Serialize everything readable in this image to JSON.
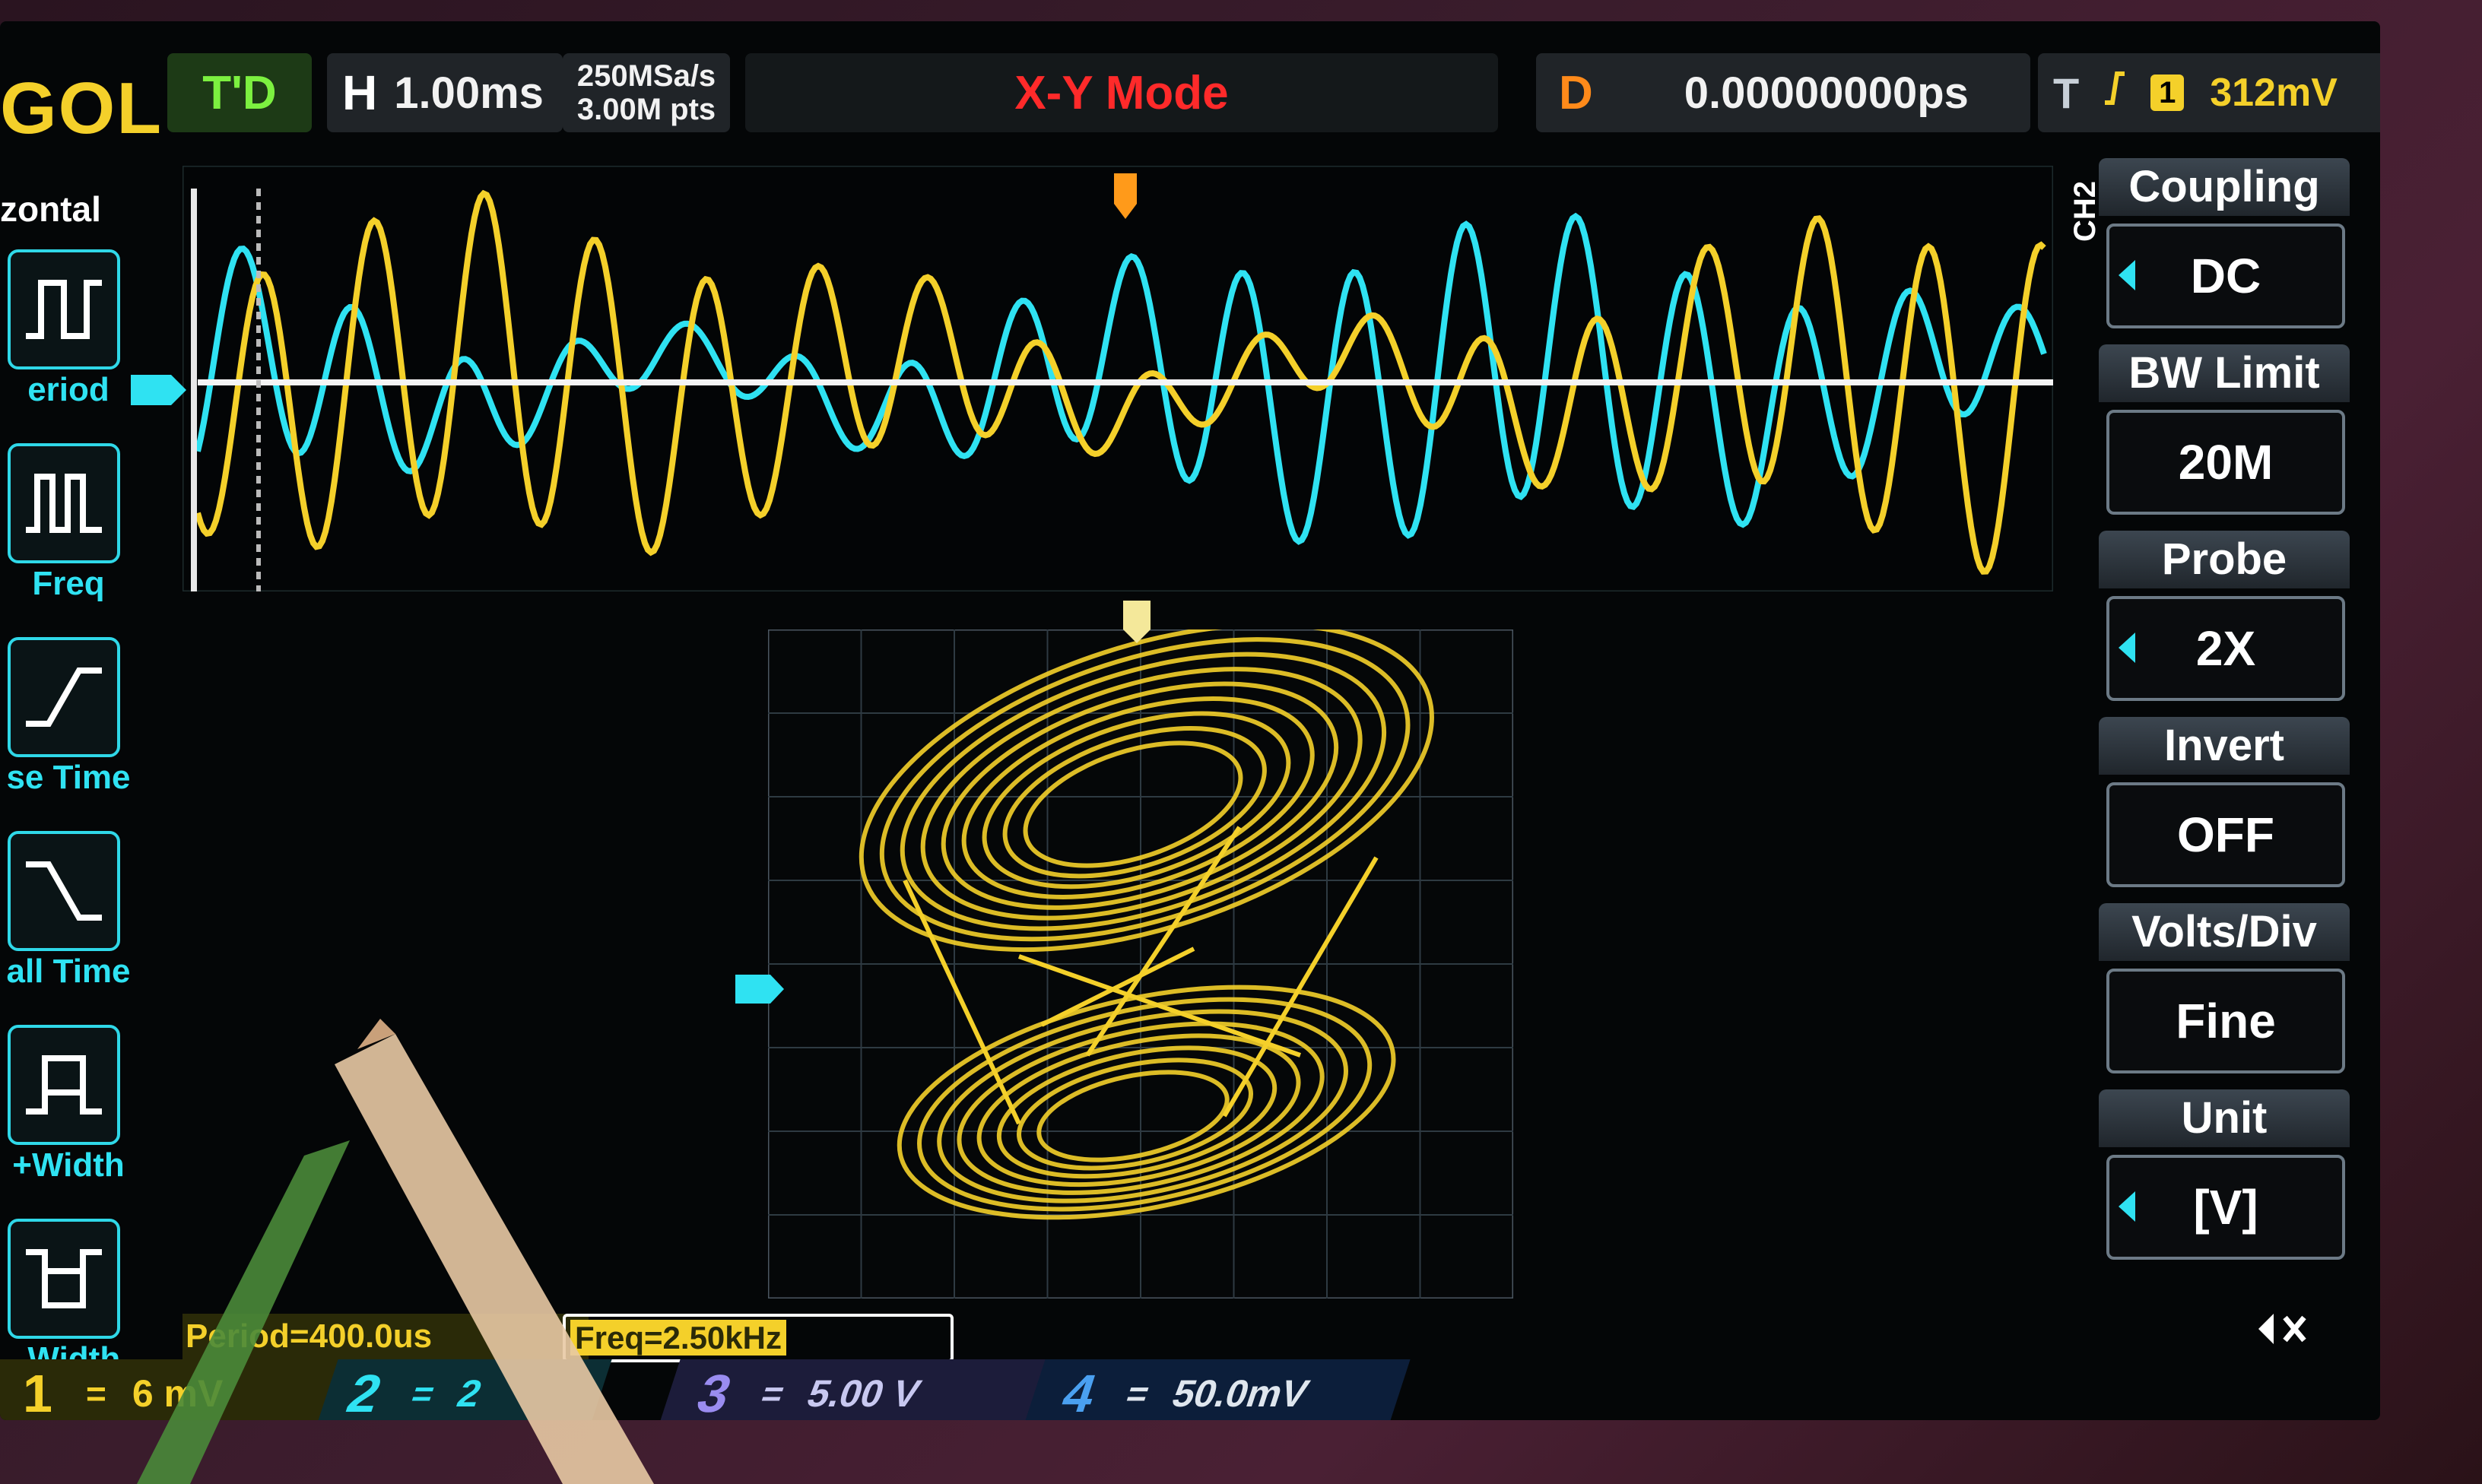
{
  "topbar": {
    "brand": "GOL",
    "trigger_state": "T'D",
    "horizontal_label": "H",
    "horizontal_scale": "1.00ms",
    "sample_rate": "250MSa/s",
    "memory_depth": "3.00M pts",
    "mode": "X-Y Mode",
    "delay_label": "D",
    "delay_value": "0.00000000ps",
    "trigger_label": "T",
    "trigger_slope_icon": "rising-edge-icon",
    "trigger_source": "1",
    "trigger_level": "312mV"
  },
  "left_menu": {
    "title": "zontal",
    "items": [
      {
        "label": "eriod",
        "icon": "period-icon"
      },
      {
        "label": "Freq",
        "icon": "frequency-icon"
      },
      {
        "label": "se Time",
        "icon": "rise-time-icon"
      },
      {
        "label": "all Time",
        "icon": "fall-time-icon"
      },
      {
        "label": "+Width",
        "icon": "positive-width-icon"
      },
      {
        "label": "-Width",
        "icon": "negative-width-icon"
      }
    ]
  },
  "right_menu": {
    "channel_tag": "CH2",
    "items": [
      {
        "title": "Coupling",
        "value": "DC"
      },
      {
        "title": "BW Limit",
        "value": "20M"
      },
      {
        "title": "Probe",
        "value": "2X"
      },
      {
        "title": "Invert",
        "value": "OFF"
      },
      {
        "title": "Volts/Div",
        "value": "Fine"
      },
      {
        "title": "Unit",
        "value": "[V]"
      }
    ]
  },
  "measurements": {
    "period": "Period=400.0us",
    "freq": "Freq=2.50kHz"
  },
  "channels": [
    {
      "num": "1",
      "coupling": "=",
      "scale": "6 mV"
    },
    {
      "num": "2",
      "coupling": "=",
      "scale": "2"
    },
    {
      "num": "3",
      "coupling": "=",
      "scale": "5.00 V"
    },
    {
      "num": "4",
      "coupling": "=",
      "scale": "50.0mV"
    }
  ],
  "colors": {
    "ch1": "#f4d02a",
    "ch2": "#2fe2f2",
    "ch3": "#9a8cf0",
    "ch4": "#4aa0f0",
    "mode_text": "#ff2a2a"
  }
}
